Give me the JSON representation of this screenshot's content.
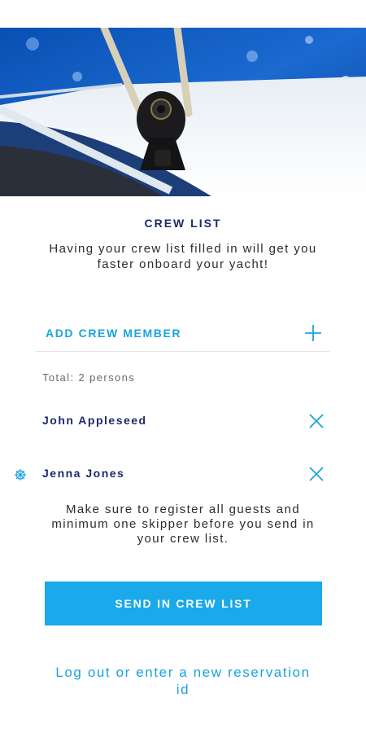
{
  "header": {
    "title": "CREW LIST",
    "subtitle": "Having your crew list filled in will get you faster onboard your yacht!"
  },
  "add_crew": {
    "label": "ADD CREW MEMBER",
    "icon": "plus-icon"
  },
  "crew": {
    "total_label": "Total: 2 persons",
    "members": [
      {
        "name": "John Appleseed",
        "remove_icon": "close-icon",
        "skipper": false
      },
      {
        "name": "Jenna Jones",
        "remove_icon": "close-icon",
        "skipper": true,
        "role_icon": "ship-wheel-icon"
      }
    ]
  },
  "note": "Make sure to register all guests and minimum one skipper before you send in your crew list.",
  "actions": {
    "send_label": "SEND IN CREW LIST",
    "logout_label": "Log out or enter a new reservation id"
  },
  "colors": {
    "accent": "#1aa9ea",
    "navy": "#1d2a6b",
    "text": "#2c2c2c"
  }
}
